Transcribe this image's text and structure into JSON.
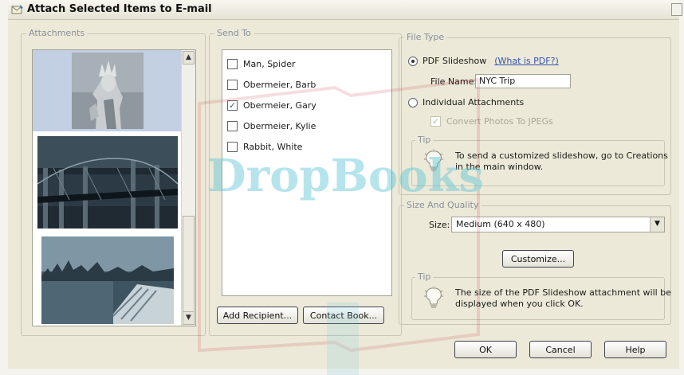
{
  "window": {
    "title": "Attach Selected Items to E-mail"
  },
  "attachments": {
    "legend": "Attachments",
    "thumbnails": [
      {
        "icon": "statue-of-liberty-photo",
        "selected": true
      },
      {
        "icon": "brooklyn-bridge-photo",
        "selected": false
      },
      {
        "icon": "city-waterfront-photo",
        "selected": false
      }
    ]
  },
  "send_to": {
    "legend": "Send To",
    "recipients": [
      {
        "name": "Man, Spider",
        "checked": false
      },
      {
        "name": "Obermeier, Barb",
        "checked": false
      },
      {
        "name": "Obermeier, Gary",
        "checked": true
      },
      {
        "name": "Obermeier, Kylie",
        "checked": false
      },
      {
        "name": "Rabbit, White",
        "checked": false
      }
    ],
    "add_recipient_label": "Add Recipient...",
    "contact_book_label": "Contact Book..."
  },
  "file_type": {
    "legend": "File Type",
    "pdf_slideshow_label": "PDF Slideshow",
    "what_is_pdf_link": "(What is PDF?)",
    "file_name_label": "File Name:",
    "file_name_value": "NYC Trip",
    "individual_attachments_label": "Individual Attachments",
    "convert_photos_label": "Convert Photos To JPEGs",
    "tip_legend": "Tip",
    "tip_text_line1": "To send a customized slideshow, go to Creations",
    "tip_text_line2": "in the main window."
  },
  "size_quality": {
    "legend": "Size And Quality",
    "size_label": "Size:",
    "size_value": "Medium (640 x 480)",
    "customize_label": "Customize...",
    "tip_legend": "Tip",
    "tip_text_line1": "The size of the PDF Slideshow attachment will be",
    "tip_text_line2": "displayed when you click OK."
  },
  "footer": {
    "ok_label": "OK",
    "cancel_label": "Cancel",
    "help_label": "Help"
  },
  "watermark": {
    "text": "DropBooks"
  },
  "colors": {
    "dialog_bg": "#ece9d8",
    "link": "#3354b3",
    "watermark": "#5cc4d6"
  }
}
